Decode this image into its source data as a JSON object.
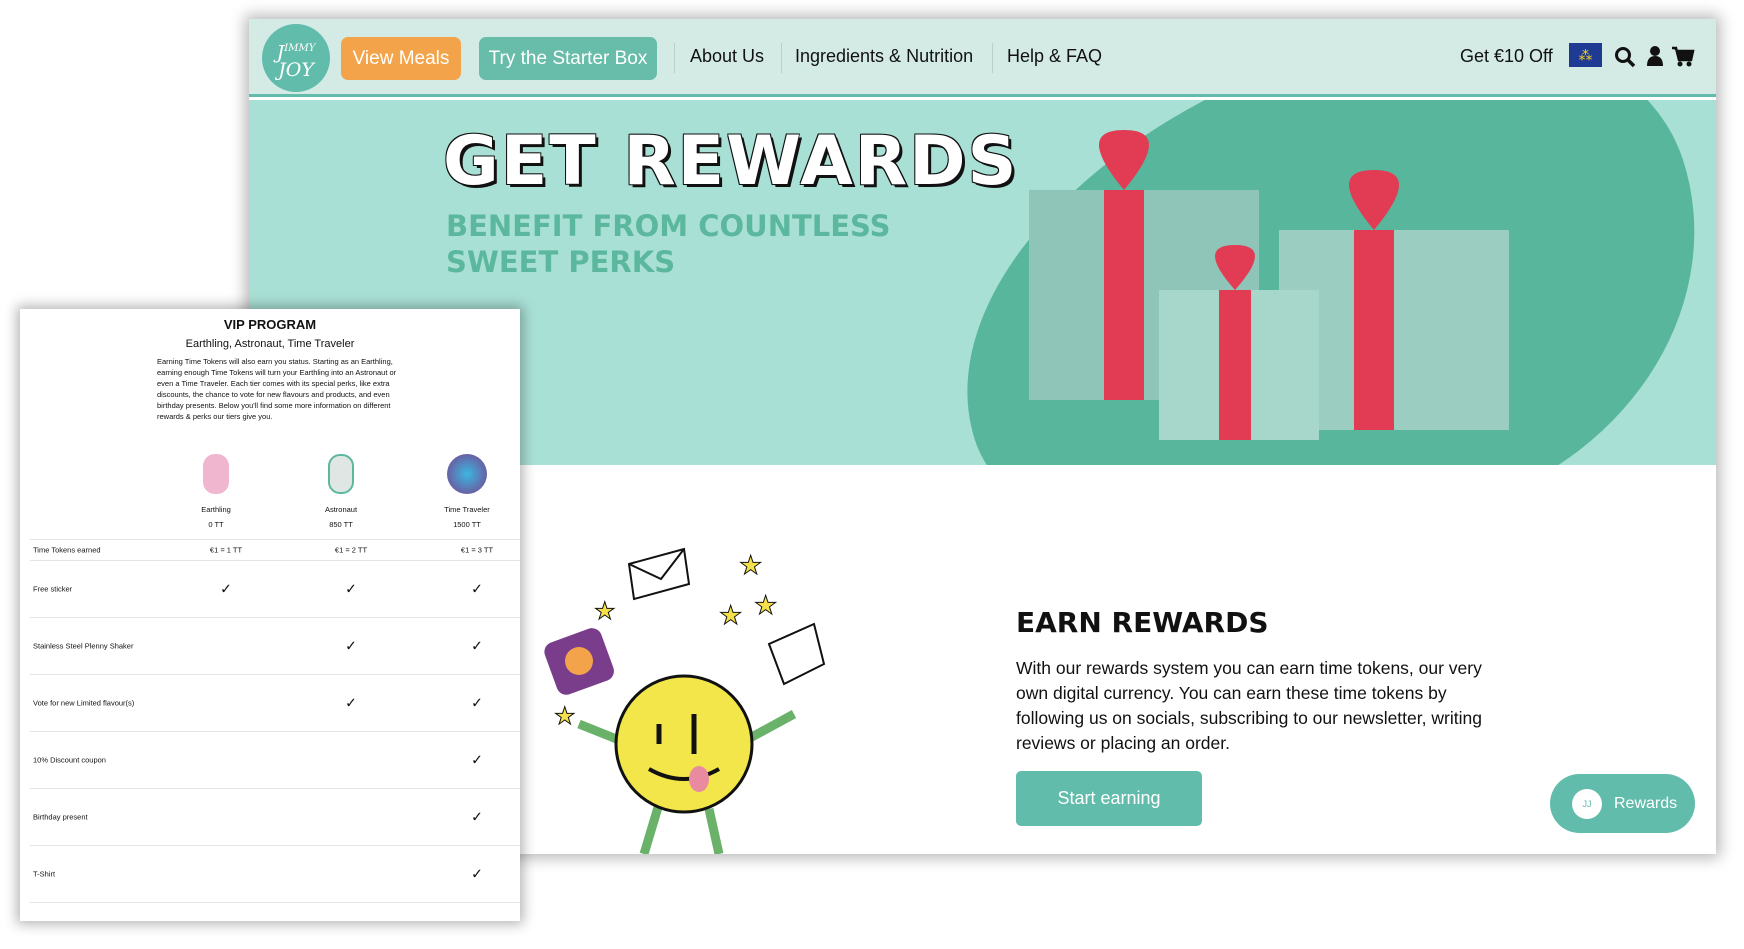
{
  "nav": {
    "logo": "Jimmy Joy",
    "view_meals": "View Meals",
    "starter_box": "Try the Starter Box",
    "links": [
      "About Us",
      "Ingredients & Nutrition",
      "Help & FAQ"
    ],
    "discount": "Get €10 Off",
    "icons": [
      "eu-flag-icon",
      "search-icon",
      "user-icon",
      "cart-icon"
    ]
  },
  "hero": {
    "title": "GET REWARDS",
    "subtitle": "BENEFIT FROM COUNTLESS SWEET PERKS"
  },
  "earn": {
    "title": "EARN REWARDS",
    "text": "With our rewards system you can earn time tokens, our very own digital currency. You can earn these time tokens by following us on socials, subscribing to our newsletter, writing reviews or placing an order.",
    "button": "Start earning"
  },
  "rewards_launcher": {
    "label": "Rewards"
  },
  "vip": {
    "title": "VIP PROGRAM",
    "subtitle": "Earthling, Astronaut, Time Traveler",
    "description": "Earning Time Tokens will also earn you status. Starting as an Earthling, earning enough Time Tokens will turn your Earthling into an Astronaut or even a Time Traveler. Each tier comes with its special perks, like extra discounts, the chance to vote for new flavours and products, and even birthday presents. Below you'll find some more information on different rewards & perks our tiers give you.",
    "tiers": [
      {
        "name": "Earthling",
        "tokens": "0 TT",
        "rate": "€1 = 1 TT"
      },
      {
        "name": "Astronaut",
        "tokens": "850 TT",
        "rate": "€1 = 2 TT"
      },
      {
        "name": "Time Traveler",
        "tokens": "1500 TT",
        "rate": "€1 = 3 TT"
      }
    ],
    "rate_label": "Time Tokens earned",
    "perks": [
      {
        "label": "Free sticker",
        "tiers": [
          true,
          true,
          true
        ]
      },
      {
        "label": "Stainless Steel Plenny Shaker",
        "tiers": [
          false,
          true,
          true
        ]
      },
      {
        "label": "Vote for new Limited flavour(s)",
        "tiers": [
          false,
          true,
          true
        ]
      },
      {
        "label": "10% Discount coupon",
        "tiers": [
          false,
          false,
          true
        ]
      },
      {
        "label": "Birthday present",
        "tiers": [
          false,
          false,
          true
        ]
      },
      {
        "label": "T-Shirt",
        "tiers": [
          false,
          false,
          true
        ]
      }
    ],
    "check": "✓"
  },
  "colors": {
    "teal": "#62bcab",
    "orange": "#f3a44b",
    "hero_bg": "#a9e0d5",
    "nav_bg": "#d4ebe5"
  }
}
